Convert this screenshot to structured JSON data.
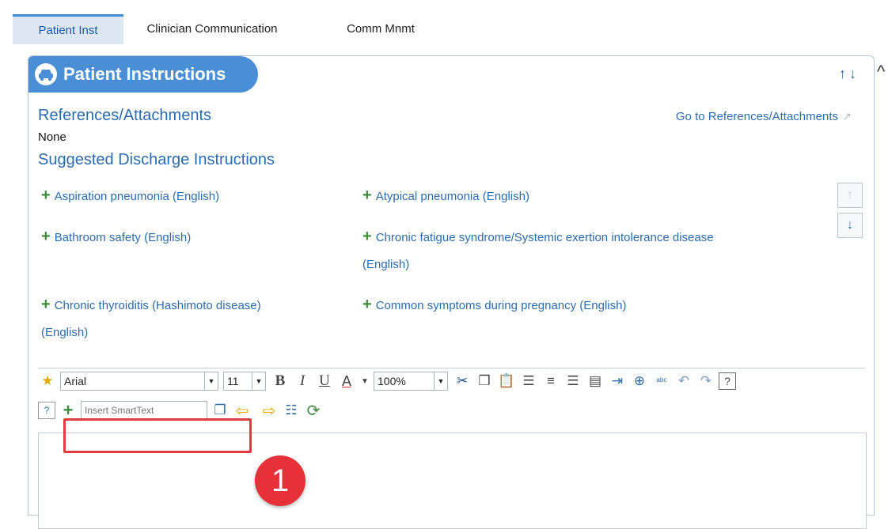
{
  "tabs": [
    {
      "label": "Patient Inst",
      "active": true
    },
    {
      "label": "Clinician Communication",
      "active": false
    },
    {
      "label": "Comm Mnmt",
      "active": false
    }
  ],
  "panel": {
    "title": "Patient Instructions",
    "header_icon": "car-icon",
    "sort_arrows": "↑↓"
  },
  "references": {
    "heading": "References/Attachments",
    "value": "None",
    "goto_link": "Go to References/Attachments"
  },
  "discharge": {
    "heading": "Suggested Discharge Instructions",
    "items": [
      {
        "line1": "Aspiration pneumonia (English)",
        "line2": ""
      },
      {
        "line1": "Atypical pneumonia (English)",
        "line2": ""
      },
      {
        "line1": "Bathroom safety (English)",
        "line2": ""
      },
      {
        "line1": "Chronic fatigue syndrome/Systemic exertion intolerance disease",
        "line2": "(English)"
      },
      {
        "line1": "Chronic thyroiditis (Hashimoto disease)",
        "line2": "(English)"
      },
      {
        "line1": "Common symptoms during pregnancy (English)",
        "line2": ""
      }
    ]
  },
  "toolbar": {
    "font_family": "Arial",
    "font_size": "11",
    "zoom": "100%",
    "bold": "B",
    "italic": "I",
    "underline": "U",
    "font_color": "A",
    "help": "?"
  },
  "smarttext": {
    "placeholder": "Insert SmartText"
  },
  "callout": {
    "number": "1",
    "color": "#e53137"
  },
  "colors": {
    "accent": "#4a8fd6",
    "link": "#2a6cb0",
    "add": "#3c8c3c"
  }
}
